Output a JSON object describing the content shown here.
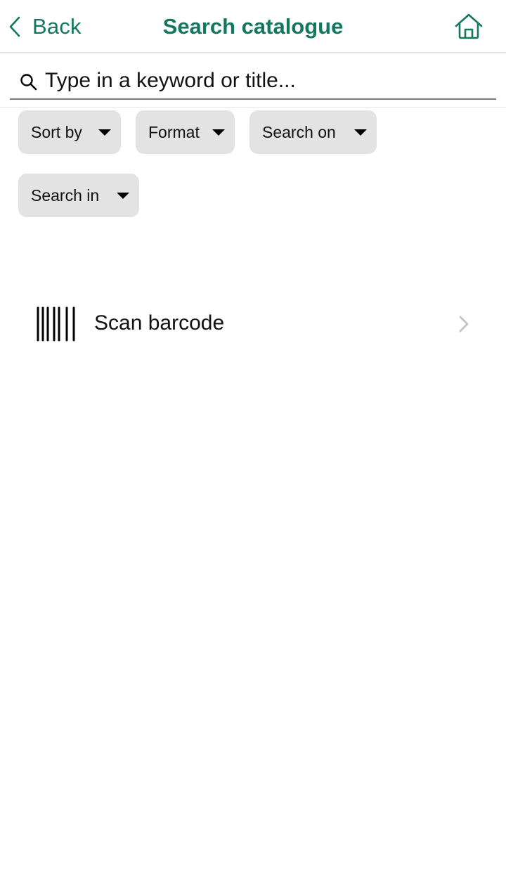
{
  "nav": {
    "back_label": "Back",
    "title": "Search catalogue",
    "back_icon": "chevron-left-icon",
    "home_icon": "home-icon"
  },
  "search": {
    "placeholder": "Type in a keyword or title...",
    "value": "",
    "icon": "search-icon"
  },
  "filters": [
    {
      "label": "Sort by"
    },
    {
      "label": "Format"
    },
    {
      "label": "Search on"
    },
    {
      "label": "Search in"
    }
  ],
  "scan": {
    "label": "Scan barcode",
    "icon": "barcode-icon",
    "chevron_icon": "chevron-right-icon"
  },
  "colors": {
    "accent": "#14785f",
    "chip_bg": "#e3e3e3",
    "divider": "#e6e6e6",
    "chevron": "#c4c4c4"
  }
}
